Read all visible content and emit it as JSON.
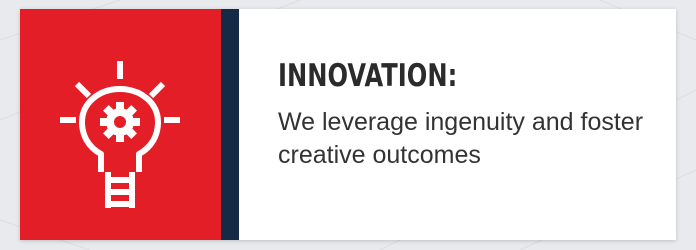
{
  "card": {
    "heading": "INNOVATION:",
    "description": "We leverage ingenuity and foster creative outcomes",
    "icon": "lightbulb-gear-ladder-icon"
  },
  "colors": {
    "accent_red": "#e31e26",
    "navy_stripe": "#152a44",
    "card_background": "#ffffff",
    "page_background": "#e9eaed",
    "heading_text": "#2b2b2b",
    "body_text": "#333333"
  }
}
